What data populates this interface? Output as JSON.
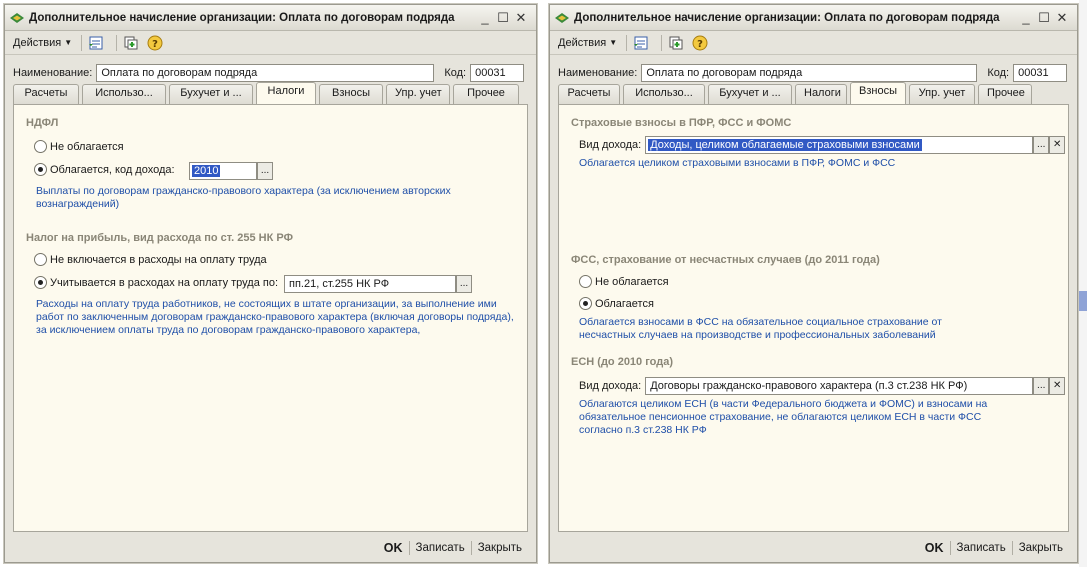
{
  "left": {
    "title": "Дополнительное начисление организации: Оплата по договорам подряда",
    "actions_label": "Действия",
    "name_label": "Наименование:",
    "name_value": "Оплата по договорам подряда",
    "code_label": "Код:",
    "code_value": "00031",
    "tabs": [
      "Расчеты",
      "Использо...",
      "Бухучет и ...",
      "Налоги",
      "Взносы",
      "Упр. учет",
      "Прочее"
    ],
    "active_tab": "Налоги",
    "ndfl": {
      "title": "НДФЛ",
      "opt1": "Не облагается",
      "opt2": "Облагается, код дохода:",
      "code": "2010",
      "note": "Выплаты по договорам гражданско-правового характера (за исключением авторских вознаграждений)"
    },
    "profit": {
      "title": "Налог на прибыль, вид расхода по ст. 255 НК РФ",
      "opt1": "Не включается в расходы на оплату труда",
      "opt2": "Учитывается в расходах на оплату труда по:",
      "value": "пп.21, ст.255 НК РФ",
      "note": "Расходы на оплату труда работников, не состоящих в штате организации, за выполнение ими работ по заключенным договорам гражданско-правового характера (включая договоры подряда), за исключением оплаты труда по договорам гражданско-правового характера,"
    },
    "buttons": {
      "ok": "OK",
      "save": "Записать",
      "close": "Закрыть"
    }
  },
  "right": {
    "title": "Дополнительное начисление организации: Оплата по договорам подряда",
    "actions_label": "Действия",
    "name_label": "Наименование:",
    "name_value": "Оплата по договорам подряда",
    "code_label": "Код:",
    "code_value": "00031",
    "tabs": [
      "Расчеты",
      "Использо...",
      "Бухучет и ...",
      "Налоги",
      "Взносы",
      "Упр. учет",
      "Прочее"
    ],
    "active_tab": "Взносы",
    "pfr": {
      "title": "Страховые взносы в ПФР, ФСС и ФОМС",
      "field_label": "Вид дохода:",
      "value": "Доходы, целиком облагаемые страховыми взносами",
      "note": "Облагается целиком страховыми взносами в ПФР, ФОМС и ФСС"
    },
    "fss": {
      "title": "ФСС, страхование от несчастных случаев (до 2011 года)",
      "opt1": "Не облагается",
      "opt2": "Облагается",
      "note": "Облагается взносами в ФСС на обязательное социальное страхование от несчастных случаев на производстве и профессиональных заболеваний"
    },
    "esn": {
      "title": "ЕСН (до 2010 года)",
      "field_label": "Вид дохода:",
      "value": "Договоры гражданско-правового характера (п.3 ст.238 НК РФ)",
      "note": "Облагаются целиком ЕСН (в части Федерального бюджета и ФОМС) и взносами на обязательное пенсионное страхование, не облагаются целиком ЕСН в части ФСС согласно п.3 ст.238 НК РФ"
    },
    "buttons": {
      "ok": "OK",
      "save": "Записать",
      "close": "Закрыть"
    }
  },
  "controls": {
    "minimize": "_",
    "maximize": "☐",
    "close": "✕"
  },
  "select_button": "...",
  "clear_button": "✕",
  "colors": {
    "accent": "#3159c4",
    "note": "#1f4fa8",
    "panel": "#fdfaee",
    "window": "#e6e4dc"
  },
  "icons": [
    "app-logo-icon",
    "open-list-icon",
    "copy-icon",
    "help-icon"
  ]
}
